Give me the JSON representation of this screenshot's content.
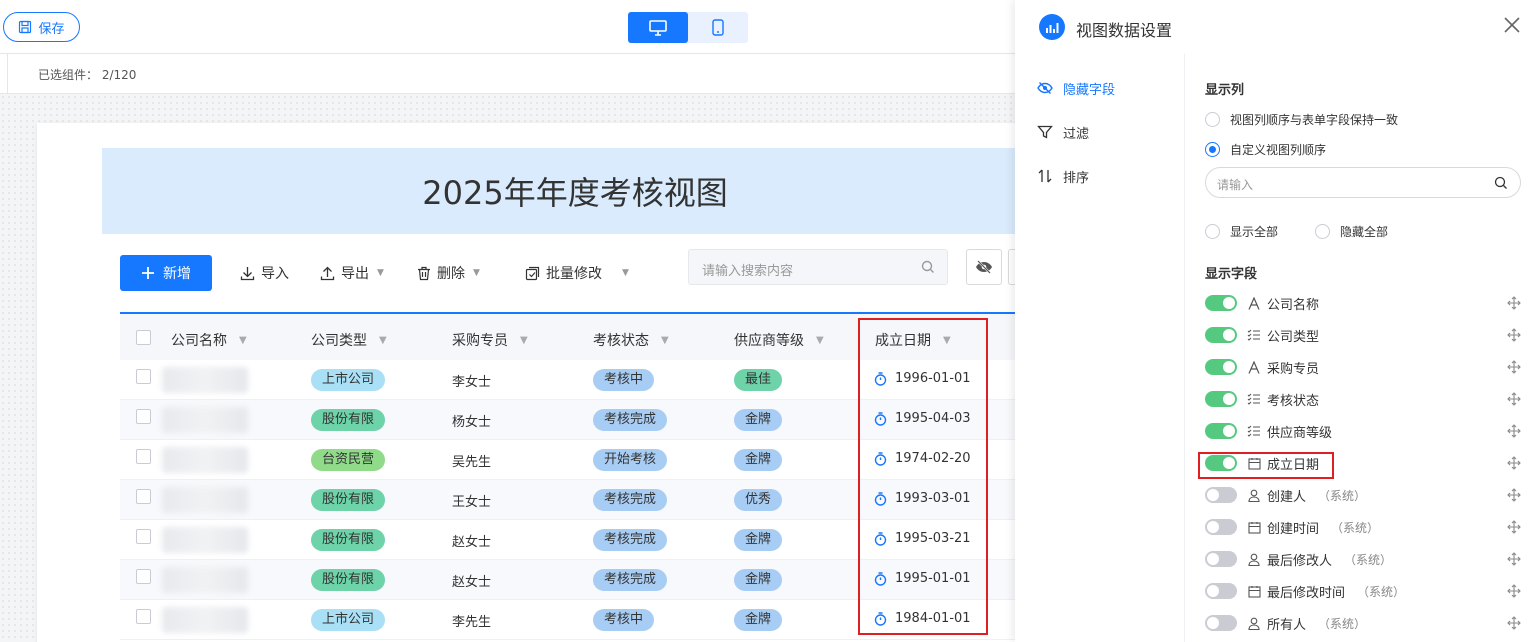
{
  "topbar": {
    "save_label": "保存"
  },
  "subbar": {
    "selected_text": "已选组件： 2/120"
  },
  "view": {
    "title": "2025年年度考核视图"
  },
  "toolbar": {
    "add_label": "新增",
    "import_label": "导入",
    "export_label": "导出",
    "delete_label": "删除",
    "batch_label": "批量修改",
    "search_placeholder": "请输入搜索内容"
  },
  "table": {
    "columns": [
      "公司名称",
      "公司类型",
      "采购专员",
      "考核状态",
      "供应商等级",
      "成立日期"
    ],
    "rows": [
      {
        "type": "上市公司",
        "buyer": "李女士",
        "status": "考核中",
        "grade": "最佳",
        "date": "1996-01-01"
      },
      {
        "type": "股份有限",
        "buyer": "杨女士",
        "status": "考核完成",
        "grade": "金牌",
        "date": "1995-04-03"
      },
      {
        "type": "台资民营",
        "buyer": "吴先生",
        "status": "开始考核",
        "grade": "金牌",
        "date": "1974-02-20"
      },
      {
        "type": "股份有限",
        "buyer": "王女士",
        "status": "考核完成",
        "grade": "优秀",
        "date": "1993-03-01"
      },
      {
        "type": "股份有限",
        "buyer": "赵女士",
        "status": "考核完成",
        "grade": "金牌",
        "date": "1995-03-21"
      },
      {
        "type": "股份有限",
        "buyer": "赵女士",
        "status": "考核完成",
        "grade": "金牌",
        "date": "1995-01-01"
      },
      {
        "type": "上市公司",
        "buyer": "李先生",
        "status": "考核中",
        "grade": "金牌",
        "date": "1984-01-01"
      }
    ]
  },
  "colors": {
    "accent": "#1677ff",
    "tag_listed": "#a9e0f5",
    "tag_share": "#6ed3a8",
    "tag_taiwan": "#8fdb8a",
    "tag_status": "#a8cdf5",
    "tag_best": "#6ed3a8",
    "tag_gold": "#a8cdf5",
    "switch_on": "#55c97f",
    "highlight": "#e02020"
  },
  "panel": {
    "title": "视图数据设置",
    "nav": [
      "隐藏字段",
      "过滤",
      "排序"
    ],
    "display_columns_title": "显示列",
    "order_option_1": "视图列顺序与表单字段保持一致",
    "order_option_2": "自定义视图列顺序",
    "search_placeholder": "请输入",
    "show_all": "显示全部",
    "hide_all": "隐藏全部",
    "display_fields_title": "显示字段",
    "system_suffix": "（系统）",
    "fields": [
      {
        "label": "公司名称",
        "on": true,
        "icon": "text-icon"
      },
      {
        "label": "公司类型",
        "on": true,
        "icon": "list-icon"
      },
      {
        "label": "采购专员",
        "on": true,
        "icon": "text-icon"
      },
      {
        "label": "考核状态",
        "on": true,
        "icon": "list-icon"
      },
      {
        "label": "供应商等级",
        "on": true,
        "icon": "list-icon"
      },
      {
        "label": "成立日期",
        "on": true,
        "icon": "calendar-icon"
      },
      {
        "label": "创建人",
        "on": false,
        "icon": "user-icon",
        "system": true
      },
      {
        "label": "创建时间",
        "on": false,
        "icon": "calendar-icon",
        "system": true
      },
      {
        "label": "最后修改人",
        "on": false,
        "icon": "user-icon",
        "system": true
      },
      {
        "label": "最后修改时间",
        "on": false,
        "icon": "calendar-icon",
        "system": true
      },
      {
        "label": "所有人",
        "on": false,
        "icon": "user-icon",
        "system": true
      }
    ]
  }
}
